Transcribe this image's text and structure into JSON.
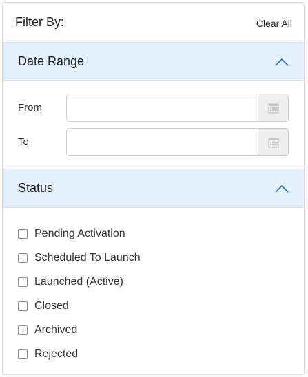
{
  "filter": {
    "title": "Filter By:",
    "clear_all_label": "Clear All"
  },
  "date_range": {
    "title": "Date Range",
    "expanded": true,
    "from_label": "From",
    "from_value": "",
    "to_label": "To",
    "to_value": "",
    "calendar_icon": "calendar-icon"
  },
  "status": {
    "title": "Status",
    "expanded": true,
    "options": [
      {
        "label": "Pending Activation",
        "checked": false
      },
      {
        "label": "Scheduled To Launch",
        "checked": false
      },
      {
        "label": "Launched (Active)",
        "checked": false
      },
      {
        "label": "Closed",
        "checked": false
      },
      {
        "label": "Archived",
        "checked": false
      },
      {
        "label": "Rejected",
        "checked": false
      }
    ]
  },
  "colors": {
    "section_header_bg": "#e3f0fc",
    "chevron": "#2a6fb0"
  }
}
